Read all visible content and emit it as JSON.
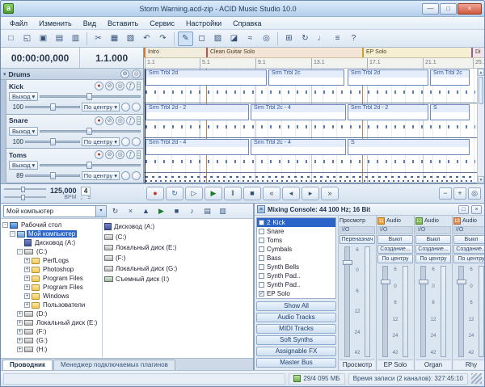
{
  "colors": {
    "accent": "#2a64c8",
    "selection": "#2a64c8",
    "clip_blue": "#2f55a0",
    "record_red": "#c03527",
    "play_green": "#1e7a2e",
    "badge_orange": "#f0a030",
    "badge_green": "#7ab648"
  },
  "icons": {
    "dropdown": "▾",
    "check": "✓",
    "arm": "●",
    "mute": "⊘",
    "solo": "◎",
    "fx": "ƒ",
    "up": "▲",
    "down": "▼",
    "minimize": "—",
    "maximize": "□",
    "close": "×",
    "logo": "a"
  },
  "window": {
    "title": "Storm Warning.acd-zip - ACID Music Studio 10.0"
  },
  "menu": {
    "items": [
      "Файл",
      "Изменить",
      "Вид",
      "Вставить",
      "Сервис",
      "Настройки",
      "Справка"
    ]
  },
  "toolbar": {
    "buttons": [
      {
        "name": "new-project-icon",
        "glyph": "□"
      },
      {
        "name": "open-project-icon",
        "glyph": "◱"
      },
      {
        "name": "save-project-icon",
        "glyph": "▣"
      },
      {
        "name": "render-as-icon",
        "glyph": "▤"
      },
      {
        "name": "properties-icon",
        "glyph": "▥"
      },
      {
        "name": "cut-icon",
        "glyph": "✂"
      },
      {
        "name": "copy-icon",
        "glyph": "▦"
      },
      {
        "name": "paste-icon",
        "glyph": "▧"
      },
      {
        "name": "undo-icon",
        "glyph": "↶"
      },
      {
        "name": "redo-icon",
        "glyph": "↷"
      },
      {
        "name": "draw-tool-icon",
        "glyph": "✎"
      },
      {
        "name": "selection-tool-icon",
        "glyph": "◻"
      },
      {
        "name": "paint-tool-icon",
        "glyph": "▨"
      },
      {
        "name": "erase-tool-icon",
        "glyph": "◪"
      },
      {
        "name": "envelope-tool-icon",
        "glyph": "≈"
      },
      {
        "name": "zoom-tool-icon",
        "glyph": "◎"
      },
      {
        "name": "snap-icon",
        "glyph": "⊞"
      },
      {
        "name": "loop-icon",
        "glyph": "↻"
      },
      {
        "name": "metronome-icon",
        "glyph": "♩"
      },
      {
        "name": "mixer-icon",
        "glyph": "≡"
      },
      {
        "name": "help-icon",
        "glyph": "?"
      }
    ]
  },
  "time_display": {
    "timecode": "00:00:00,000",
    "position": "1.1.000"
  },
  "track_panel": {
    "group": {
      "name": "Drums"
    },
    "output_label": "Выход",
    "tracks": [
      {
        "name": "Kick",
        "volume": "100",
        "pan": "По центру"
      },
      {
        "name": "Snare",
        "volume": "100",
        "pan": "По центру"
      },
      {
        "name": "Toms",
        "volume": "89",
        "pan": "По центру"
      }
    ]
  },
  "timeline": {
    "sections": [
      {
        "label": "Intro"
      },
      {
        "label": "Clean Guitar Solo"
      },
      {
        "label": "EP Solo"
      },
      {
        "label": "Di"
      }
    ],
    "ruler": [
      "1.1",
      "5.1",
      "9.1",
      "13.1",
      "17.1",
      "21.1",
      "25.1"
    ],
    "lanes": [
      {
        "clips": [
          {
            "label": "Srm Trbl 2d"
          },
          {
            "label": "Srm Trbl 2c"
          },
          {
            "label": "Srm Trbl 2d"
          },
          {
            "label": "Srm Trbl 2c"
          }
        ]
      },
      {
        "clips": [
          {
            "label": "Srm Trbl 2d - 2"
          },
          {
            "label": "Srm Trbl 2c - 4"
          },
          {
            "label": "Srm Trbl 2d - 2"
          },
          {
            "label": "S"
          }
        ]
      },
      {
        "clips": [
          {
            "label": "Srm Trbl 2d - 4"
          },
          {
            "label": "Srm Trbl 2c - 4"
          },
          {
            "label": "S"
          }
        ]
      }
    ]
  },
  "transport": {
    "bpm": "125,000",
    "bpm_label": "BPM",
    "time_sig": "4",
    "tempo_note": "♩ =",
    "buttons": [
      {
        "name": "record-button",
        "glyph": "●"
      },
      {
        "name": "loop-playback-button",
        "glyph": "↻"
      },
      {
        "name": "play-from-start-button",
        "glyph": "▷"
      },
      {
        "name": "play-button",
        "glyph": "▶"
      },
      {
        "name": "pause-button",
        "glyph": "‖"
      },
      {
        "name": "stop-button",
        "glyph": "■"
      },
      {
        "name": "go-to-start-button",
        "glyph": "«"
      },
      {
        "name": "step-back-button",
        "glyph": "◂"
      },
      {
        "name": "step-forward-button",
        "glyph": "▸"
      },
      {
        "name": "go-to-end-button",
        "glyph": "»"
      }
    ],
    "zoom_buttons": [
      {
        "name": "zoom-out-button",
        "glyph": "−"
      },
      {
        "name": "zoom-in-button",
        "glyph": "+"
      },
      {
        "name": "zoom-tool-button",
        "glyph": "◎"
      }
    ]
  },
  "explorer": {
    "address": "Мой компьютер",
    "toolbar": [
      {
        "name": "refresh-icon",
        "glyph": "↻"
      },
      {
        "name": "delete-icon",
        "glyph": "×"
      },
      {
        "name": "up-folder-icon",
        "glyph": "▲"
      },
      {
        "name": "play-preview-icon",
        "glyph": "▶"
      },
      {
        "name": "stop-preview-icon",
        "glyph": "■"
      },
      {
        "name": "auto-preview-icon",
        "glyph": "♪"
      },
      {
        "name": "views-icon",
        "glyph": "▤"
      },
      {
        "name": "tree-view-icon",
        "glyph": "▥"
      }
    ],
    "tree": [
      {
        "label": "Рабочий стол",
        "exp": "-"
      },
      {
        "label": "Мой компьютер",
        "exp": "-"
      },
      {
        "label": "Дисковод (A:)",
        "exp": ""
      },
      {
        "label": "(C:)",
        "exp": "-"
      },
      {
        "label": "PerfLogs",
        "exp": "+"
      },
      {
        "label": "Photoshop",
        "exp": "+"
      },
      {
        "label": "Program Files",
        "exp": "+"
      },
      {
        "label": "Program Files",
        "exp": "+"
      },
      {
        "label": "Windows",
        "exp": "+"
      },
      {
        "label": "Пользователи",
        "exp": "+"
      },
      {
        "label": "(D:)",
        "exp": "+"
      },
      {
        "label": "Локальный диск (E:)",
        "exp": "+"
      },
      {
        "label": "(F:)",
        "exp": "+"
      },
      {
        "label": "(G:)",
        "exp": "+"
      },
      {
        "label": "(H:)",
        "exp": "+"
      }
    ],
    "files": [
      {
        "label": "Дисковод (A:)"
      },
      {
        "label": "(C:)"
      },
      {
        "label": "Локальный диск (E:)"
      },
      {
        "label": "(F:)"
      },
      {
        "label": "Локальный диск (G:)"
      },
      {
        "label": "Съемный диск (I:)"
      }
    ],
    "tabs": [
      {
        "label": "Проводник"
      },
      {
        "label": "Менеджер подключаемых плагинов"
      }
    ]
  },
  "mixer": {
    "title": "Mixing Console: 44 100 Hz; 16 Bit",
    "track_list": [
      {
        "num": "2",
        "label": "Kick"
      },
      {
        "num": "",
        "label": "Snare"
      },
      {
        "num": "",
        "label": "Toms"
      },
      {
        "num": "",
        "label": "Cymbals"
      },
      {
        "num": "",
        "label": "Bass"
      },
      {
        "num": "",
        "label": "Synth Bells"
      },
      {
        "num": "",
        "label": "Synth Pad.."
      },
      {
        "num": "",
        "label": "Synth Pad.."
      },
      {
        "num": "",
        "label": "EP Solo"
      }
    ],
    "filter_buttons": [
      "Show All",
      "Audio Tracks",
      "MIDI Tracks",
      "Soft Synths",
      "Assignable FX",
      "Master Bus"
    ],
    "scale": [
      "6",
      "0",
      "6",
      "12",
      "24",
      "42"
    ],
    "strips": [
      {
        "header": "Просмотр",
        "io": "I/O",
        "slot": "Переназнач",
        "name": "Просмотр"
      },
      {
        "badge": "11",
        "type": "Audio",
        "io": "I/O",
        "mute": "Выкл",
        "slot": "Создание...",
        "pan": "По центру",
        "name": "EP Solo"
      },
      {
        "badge": "12",
        "type": "Audio",
        "io": "I/O",
        "mute": "Выкл",
        "slot": "Создание...",
        "pan": "По центру",
        "name": "Organ"
      },
      {
        "badge": "13",
        "type": "Audio",
        "io": "I/O",
        "mute": "Выкл",
        "slot": "Создание...",
        "pan": "По центру",
        "name": "Rhy"
      }
    ]
  },
  "status": {
    "memory": "29/4 095 МБ",
    "record_time": "Время записи (2 каналов): 327:45:10"
  }
}
